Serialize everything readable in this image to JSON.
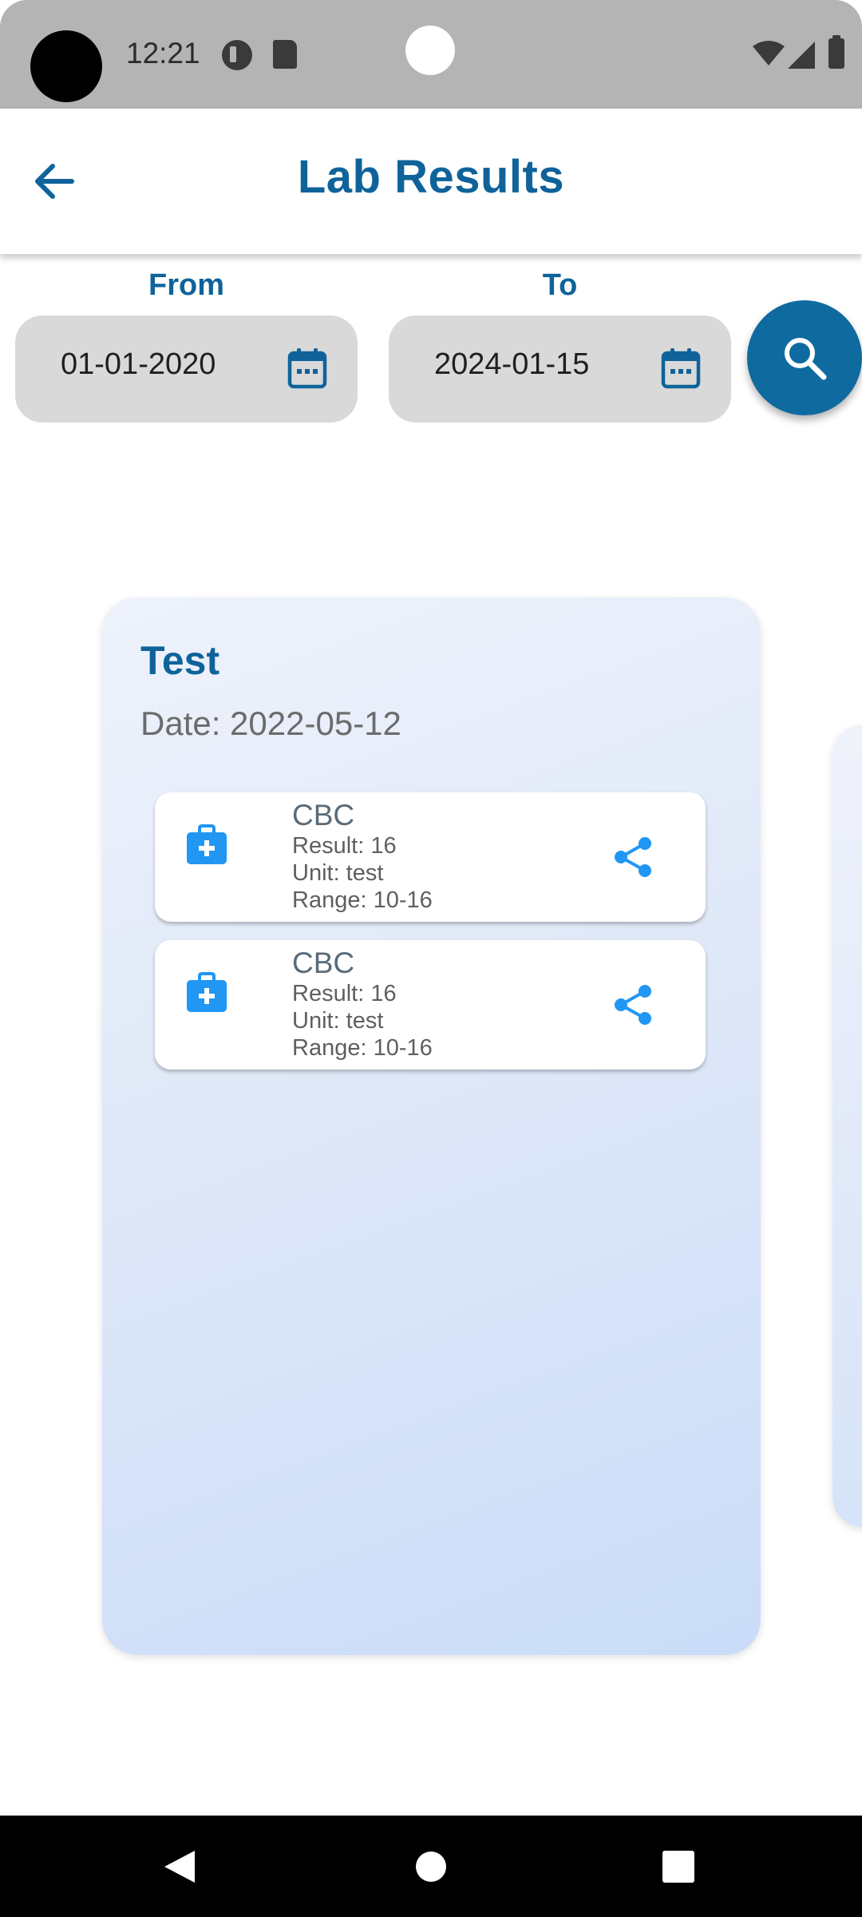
{
  "status_bar": {
    "time": "12:21",
    "icons": [
      "camera-cutout",
      "notification-icon",
      "sd-card-icon",
      "wifi-icon",
      "signal-icon",
      "battery-icon"
    ]
  },
  "app_bar": {
    "title": "Lab Results",
    "back_icon": "arrow-left-icon"
  },
  "filters": {
    "from_label": "From",
    "from_value": "01-01-2020",
    "to_label": "To",
    "to_value": "2024-01-15",
    "calendar_icon": "calendar-icon",
    "search_icon": "search-icon"
  },
  "cards": [
    {
      "title": "Test",
      "date": "Date: 2022-05-12",
      "results": [
        {
          "name": "CBC",
          "result": "Result: 16",
          "unit": "Unit: test",
          "range": "Range: 10-16",
          "icon": "medical-kit-icon",
          "action_icon": "share-icon"
        },
        {
          "name": "CBC",
          "result": "Result: 16",
          "unit": "Unit: test",
          "range": "Range: 10-16",
          "icon": "medical-kit-icon",
          "action_icon": "share-icon"
        }
      ]
    }
  ],
  "colors": {
    "primary": "#0f639a",
    "fab": "#0f6aa0",
    "accent_icon": "#2196f3",
    "field_bg": "#d9d9d9",
    "status_bar": "#b4b4b4"
  },
  "nav_bar": {
    "icons": [
      "nav-back-icon",
      "nav-home-icon",
      "nav-recents-icon"
    ]
  }
}
